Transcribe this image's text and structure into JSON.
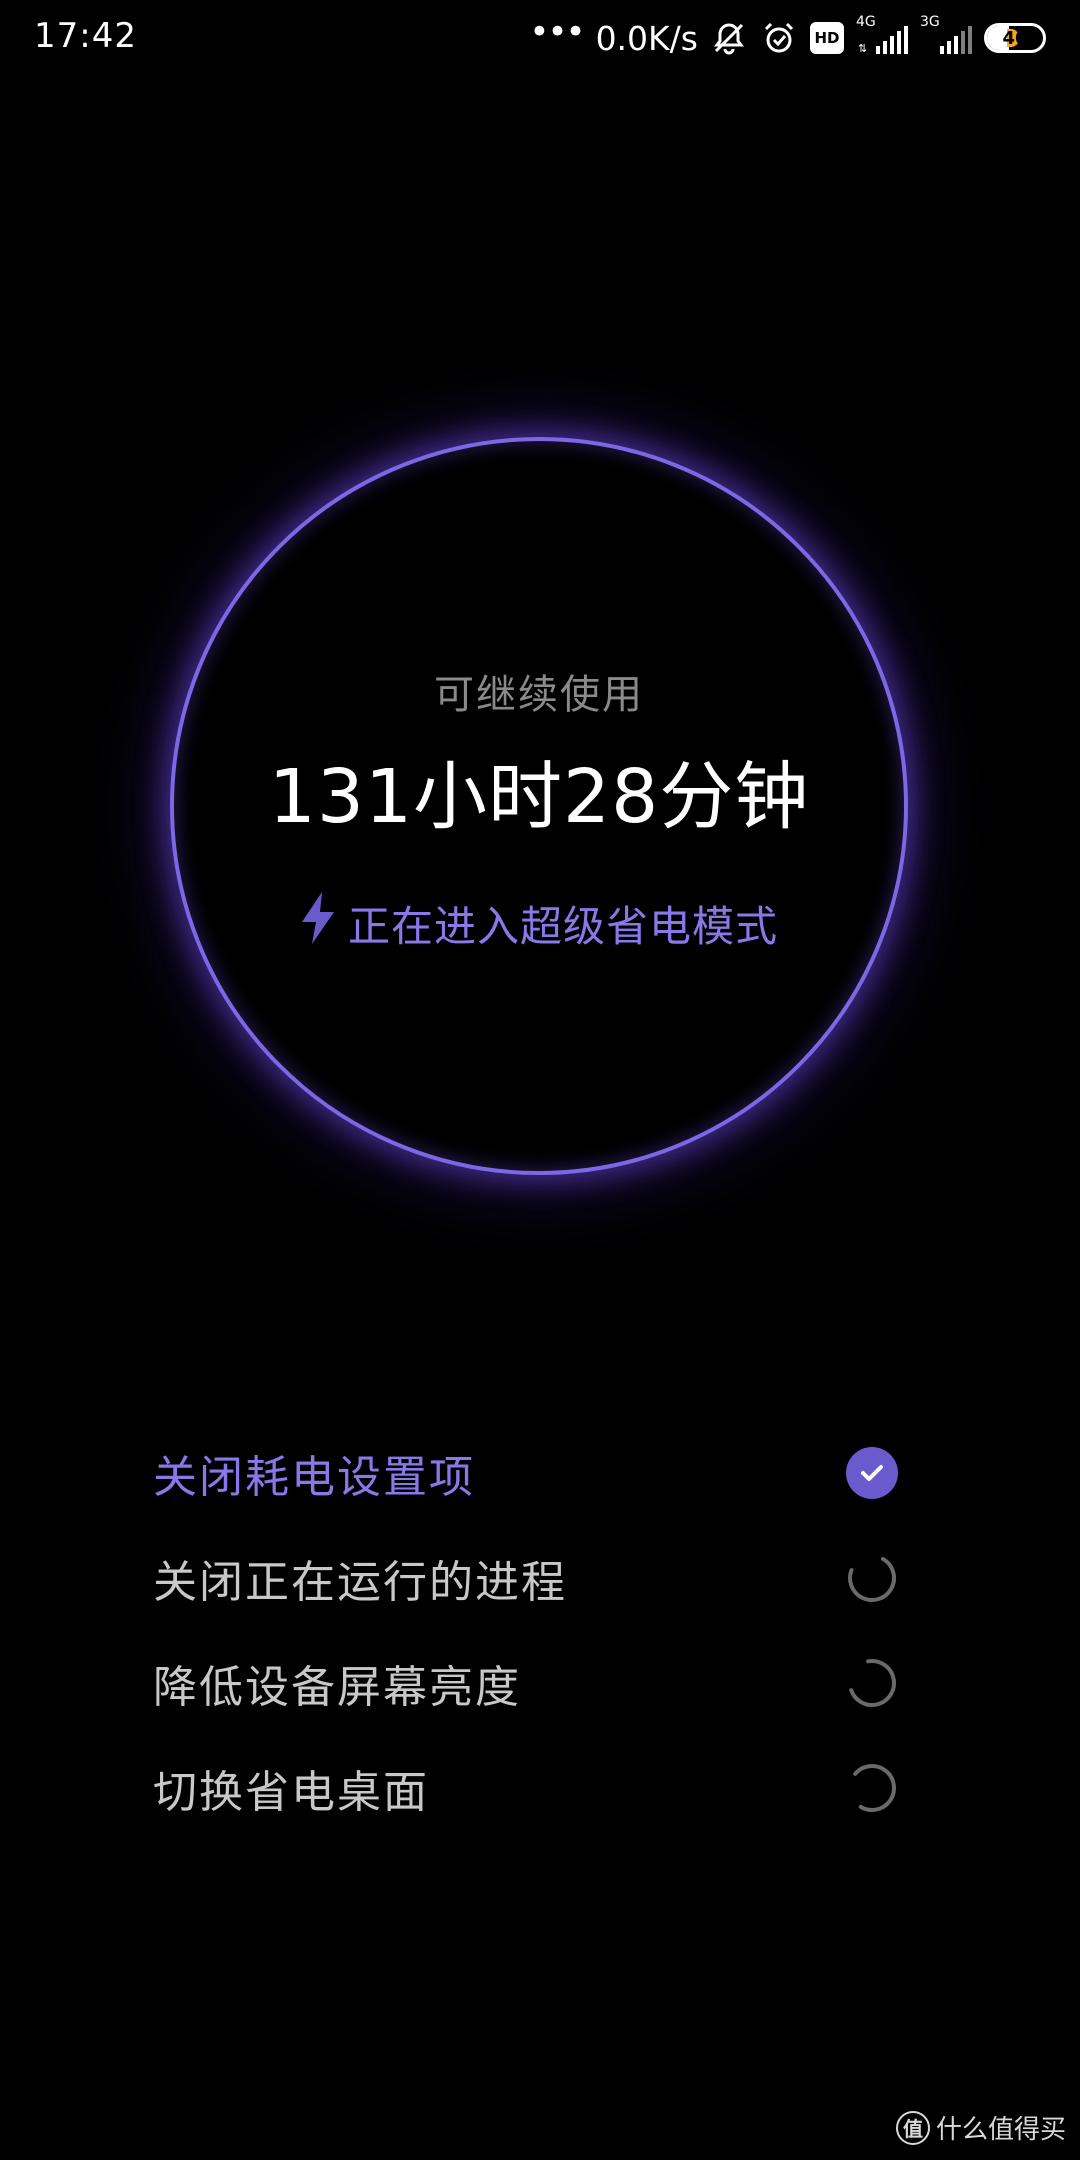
{
  "status_bar": {
    "time": "17:42",
    "net_dots": "•••",
    "net_speed": "0.0K/s",
    "icons": [
      "mute-bell-icon",
      "alarm-icon",
      "hd-icon",
      "signal-4g-icon",
      "signal-3g-icon",
      "battery-icon"
    ],
    "hd_label": "HD",
    "sim1_gen": "4G",
    "sim2_gen": "3G",
    "battery_percent": "40",
    "battery_level": 0.4,
    "battery_color": "#f5a623"
  },
  "ring": {
    "label": "可继续使用",
    "time": "131小时28分钟",
    "status": "正在进入超级省电模式",
    "status_icon": "lightning-bolt-icon",
    "accent_color": "#7b68e4"
  },
  "tasks": [
    {
      "label": "关闭耗电设置项",
      "state": "done",
      "icon": "check-circle-icon"
    },
    {
      "label": "关闭正在运行的进程",
      "state": "loading",
      "icon": "spinner-icon"
    },
    {
      "label": "降低设备屏幕亮度",
      "state": "loading",
      "icon": "spinner-icon"
    },
    {
      "label": "切换省电桌面",
      "state": "loading",
      "icon": "spinner-icon"
    }
  ],
  "watermark": {
    "logo": "值",
    "text": "什么值得买"
  }
}
